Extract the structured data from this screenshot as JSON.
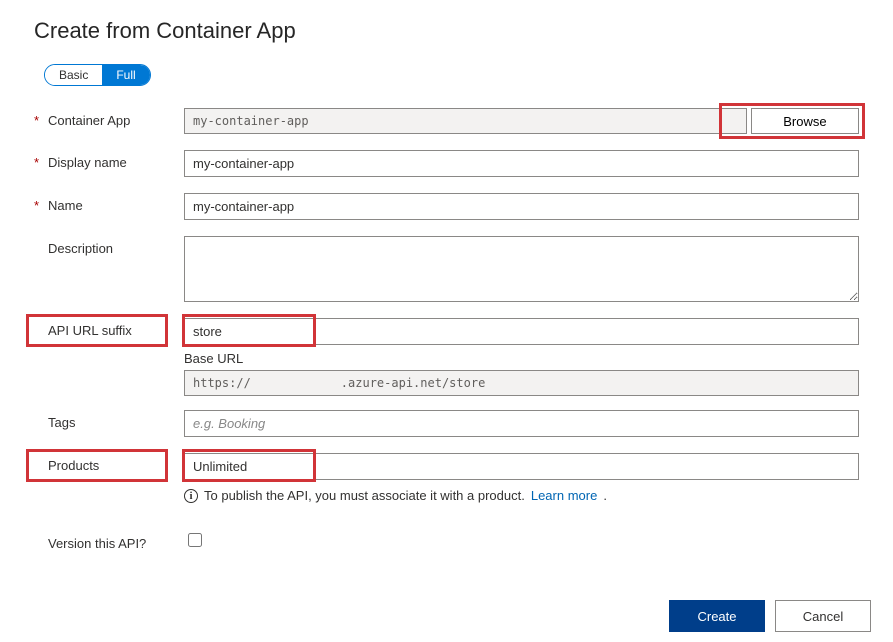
{
  "title": "Create from Container App",
  "modeToggle": {
    "basic": "Basic",
    "full": "Full"
  },
  "form": {
    "containerApp": {
      "label": "Container App",
      "value": "my-container-app",
      "required": true
    },
    "browseBtn": "Browse",
    "displayName": {
      "label": "Display name",
      "value": "my-container-app",
      "required": true
    },
    "name": {
      "label": "Name",
      "value": "my-container-app",
      "required": true
    },
    "description": {
      "label": "Description",
      "value": ""
    },
    "apiUrlSuffix": {
      "label": "API URL suffix",
      "value": "store"
    },
    "baseUrl": {
      "label": "Base URL",
      "scheme": "https://",
      "host": ".azure-api.net/store"
    },
    "tags": {
      "label": "Tags",
      "placeholder": "e.g. Booking",
      "value": ""
    },
    "products": {
      "label": "Products",
      "value": "Unlimited"
    },
    "publishNote": "To publish the API, you must associate it with a product.",
    "learnMore": "Learn more",
    "versionThisApi": {
      "label": "Version this API?",
      "checked": false
    }
  },
  "footer": {
    "create": "Create",
    "cancel": "Cancel"
  }
}
